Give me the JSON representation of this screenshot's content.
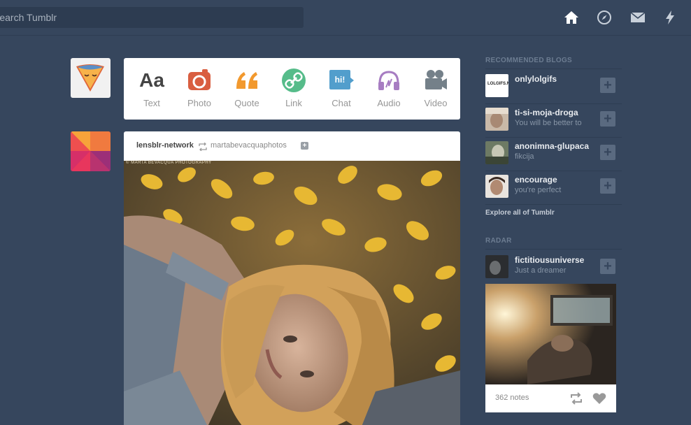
{
  "search": {
    "placeholder": "Search Tumblr",
    "value": ""
  },
  "nav": {
    "icons": [
      "home-icon",
      "compass-icon",
      "mail-icon",
      "lightning-icon"
    ]
  },
  "composer": {
    "types": [
      {
        "label": "Text",
        "glyph": "Aa",
        "color": "#444444"
      },
      {
        "label": "Photo",
        "color": "#d95e40"
      },
      {
        "label": "Quote",
        "glyph": "“",
        "color": "#f2992e"
      },
      {
        "label": "Link",
        "color": "#56bc8a"
      },
      {
        "label": "Chat",
        "glyph": "hi!",
        "color": "#529ecc"
      },
      {
        "label": "Audio",
        "color": "#a77dc2"
      },
      {
        "label": "Video",
        "color": "#748089"
      }
    ]
  },
  "post": {
    "author": "lensblr-network",
    "source": "martabevacquaphotos",
    "watermark": "© MARTA BEVACQUA PHOTOGRAPHY"
  },
  "sidebar": {
    "recommended_title": "RECOMMENDED BLOGS",
    "blogs": [
      {
        "name": "onlylolgifs",
        "sub": "",
        "avatar_text": "LOLGIFS.NET"
      },
      {
        "name": "ti-si-moja-droga",
        "sub": "You will be better to"
      },
      {
        "name": "anonimna-glupaca",
        "sub": "fikcija"
      },
      {
        "name": "encourage",
        "sub": "you're perfect"
      }
    ],
    "explore": "Explore all of Tumblr",
    "radar_title": "RADAR",
    "radar": {
      "name": "fictitiousuniverse",
      "sub": "Just a dreamer",
      "notes": "362 notes"
    }
  },
  "colors": {
    "background": "#36465d",
    "panel": "#ffffff",
    "accent": "#529ecc"
  }
}
